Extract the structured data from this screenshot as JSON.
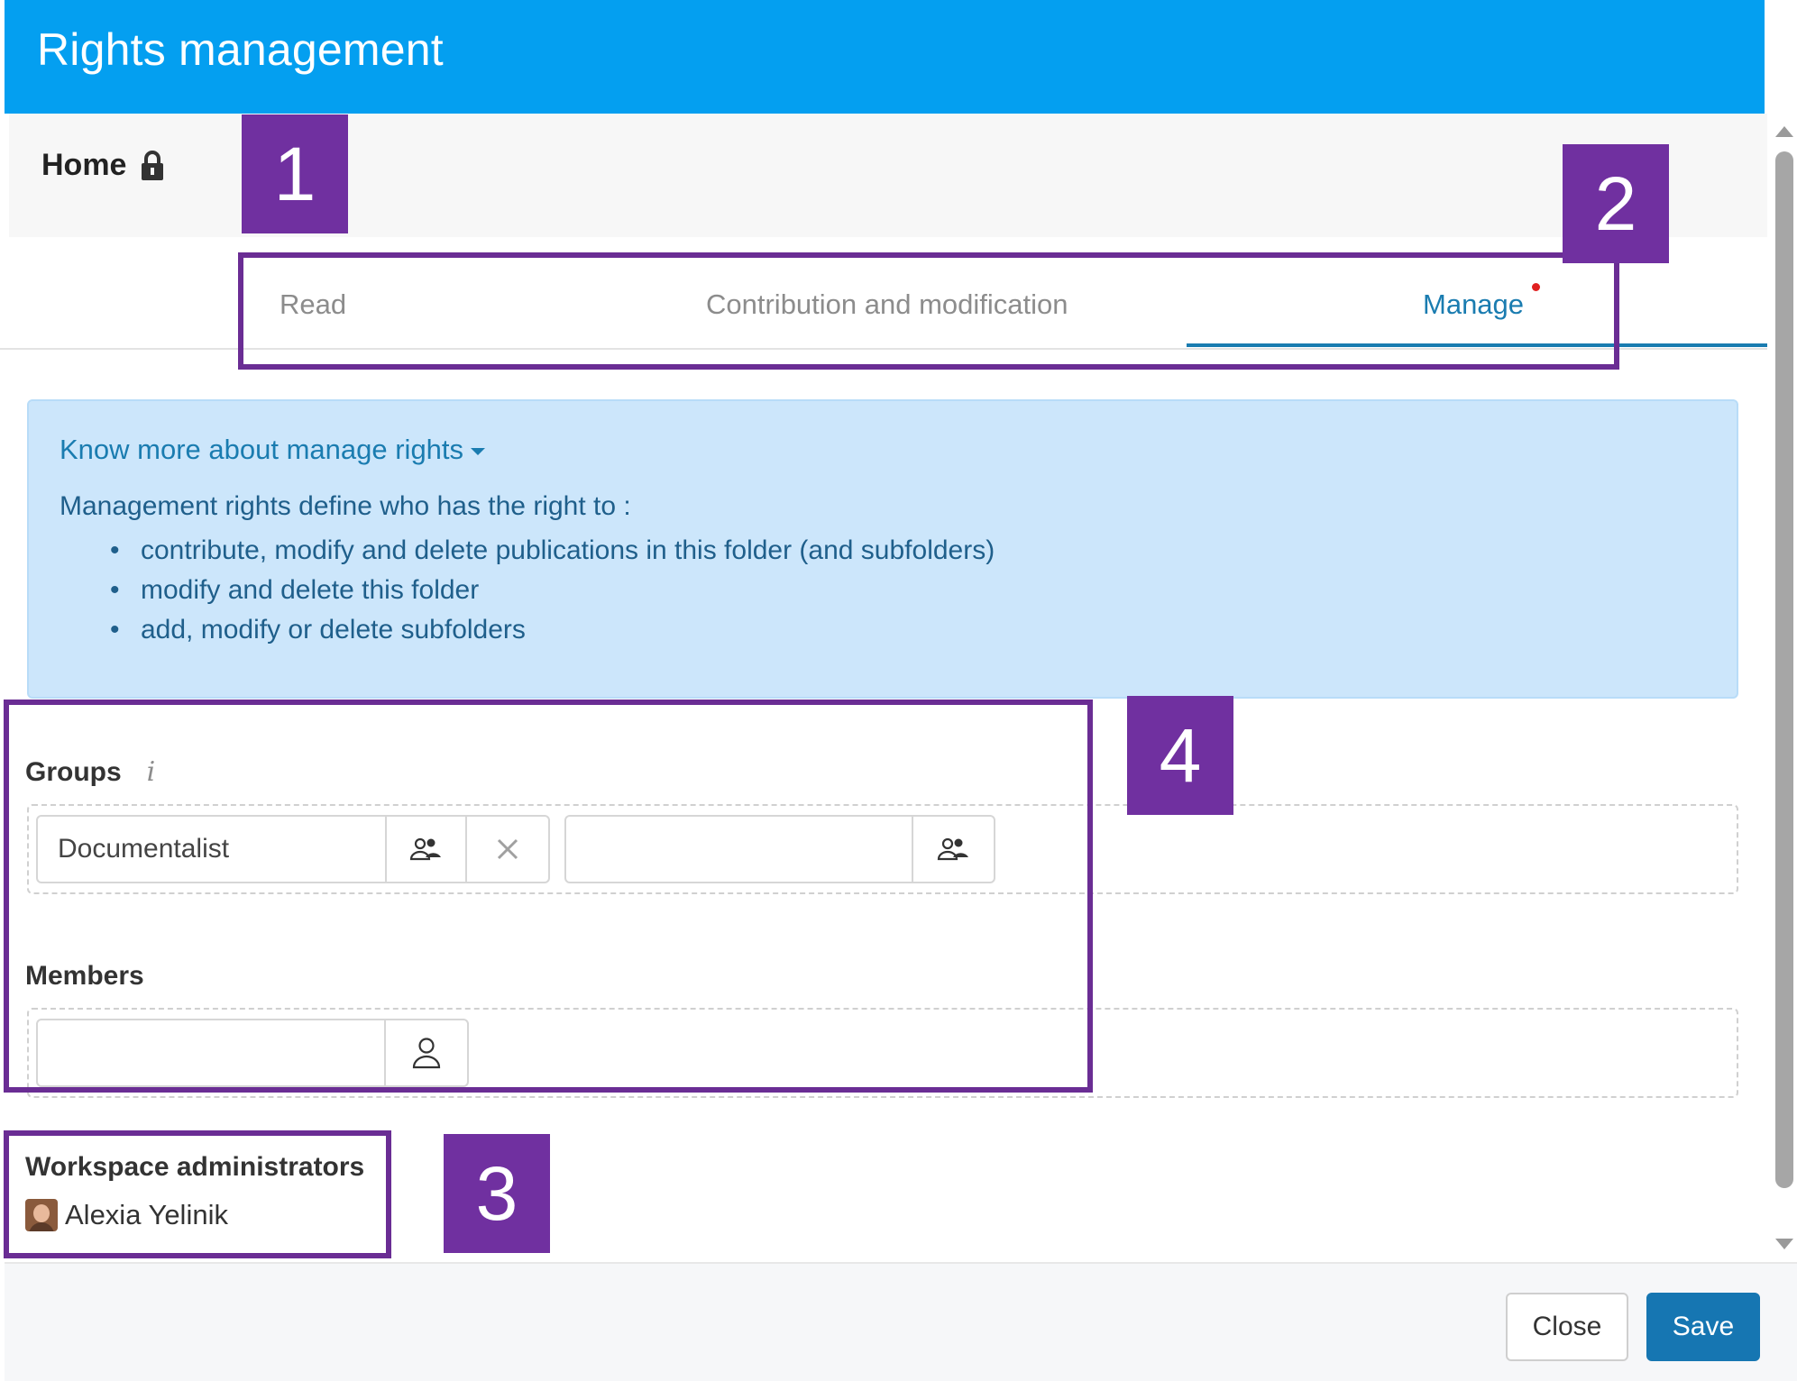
{
  "header": {
    "title": "Rights management"
  },
  "breadcrumb": {
    "label": "Home",
    "icon": "lock-icon"
  },
  "tabs": [
    {
      "label": "Read",
      "active": false
    },
    {
      "label": "Contribution and modification",
      "active": false
    },
    {
      "label": "Manage",
      "active": true,
      "indicator": "red-dot"
    }
  ],
  "info": {
    "link": "Know more about manage rights",
    "intro": "Management rights define who has the right to :",
    "items": [
      "contribute, modify and delete publications in this folder (and subfolders)",
      "modify and delete this folder",
      "add, modify or delete subfolders"
    ]
  },
  "groups": {
    "label": "Groups",
    "info_icon": "i",
    "entries": [
      {
        "value": "Documentalist",
        "placeholder": ""
      },
      {
        "value": "",
        "placeholder": ""
      }
    ]
  },
  "members": {
    "label": "Members",
    "entries": [
      {
        "value": "",
        "placeholder": ""
      }
    ]
  },
  "workspace_admins": {
    "title": "Workspace administrators",
    "people": [
      {
        "name": "Alexia Yelinik"
      }
    ]
  },
  "footer": {
    "close_label": "Close",
    "save_label": "Save"
  },
  "annotations": {
    "n1": "1",
    "n2": "2",
    "n3": "3",
    "n4": "4"
  },
  "colors": {
    "header": "#049ff0",
    "accent": "#1a7cb0",
    "info_bg": "#cce6fb",
    "annotation": "#7030a0",
    "save": "#1676b2"
  }
}
